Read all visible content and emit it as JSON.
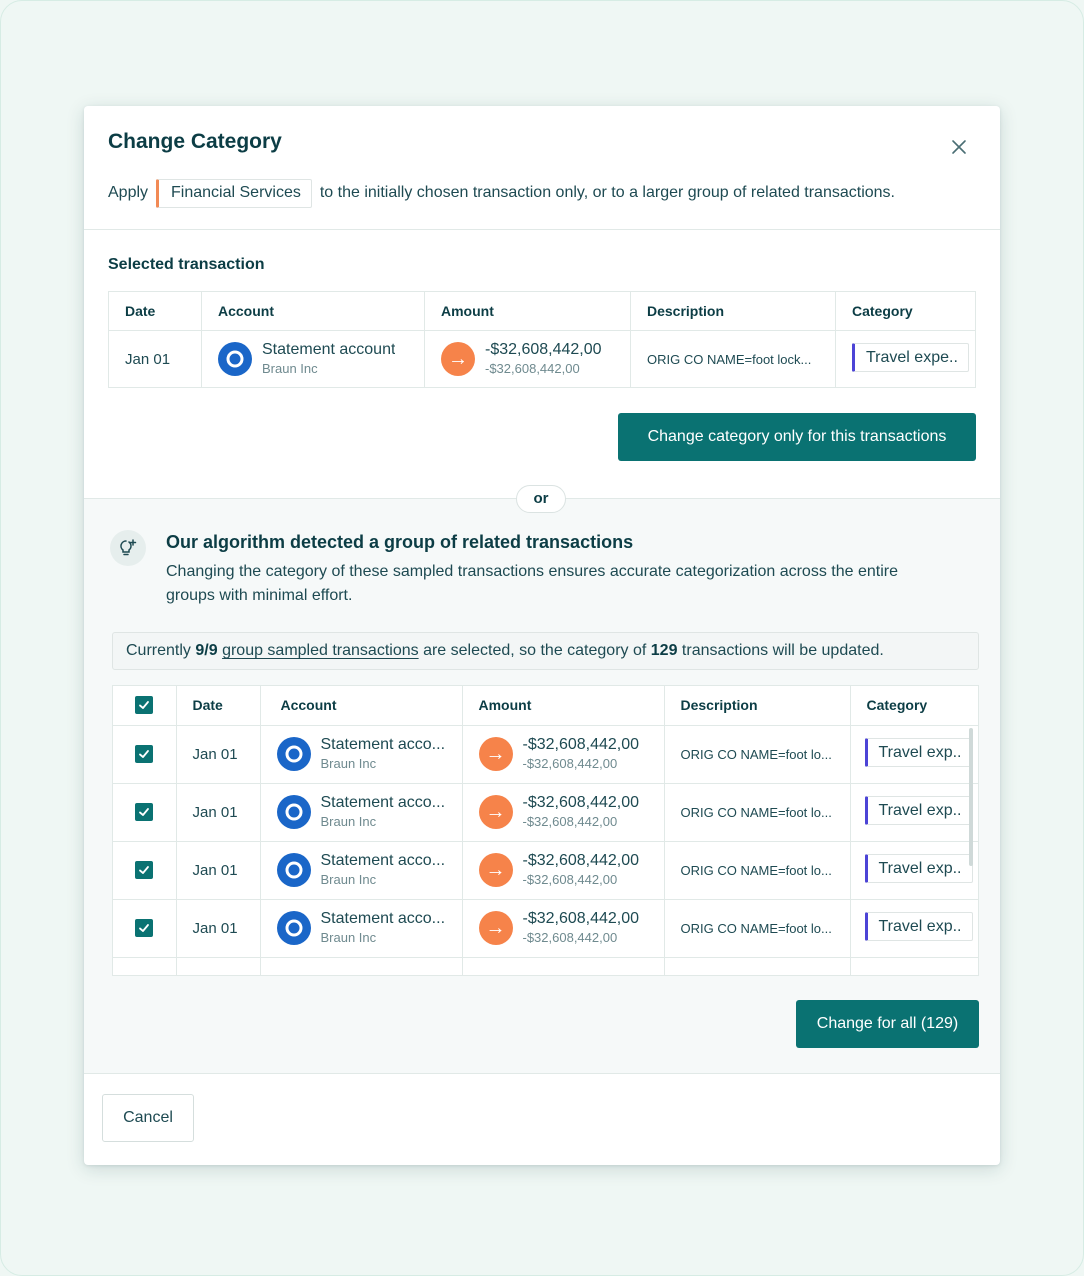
{
  "modal": {
    "title": "Change Category",
    "apply_prefix": "Apply",
    "apply_category": "Financial Services",
    "apply_suffix": "to the initially chosen transaction only, or to a larger group of related transactions."
  },
  "selected": {
    "label": "Selected transaction",
    "columns": [
      "Date",
      "Account",
      "Amount",
      "Description",
      "Category"
    ],
    "row": {
      "date": "Jan 01",
      "account": "Statement account",
      "account_sub": "Braun Inc",
      "amount": "-$32,608,442,00",
      "amount_sub": "-$32,608,442,00",
      "description": "ORIG CO NAME=foot lock...",
      "category": "Travel expe.."
    },
    "button_label": "Change category only for this transactions"
  },
  "divider": {
    "label": "or"
  },
  "group": {
    "title": "Our algorithm detected a group of related transactions",
    "description": "Changing the category of these sampled transactions ensures accurate categorization across the entire groups with minimal effort.",
    "notice": {
      "prefix": "Currently ",
      "selected_count": "9/9",
      "link": "group sampled transactions",
      "middle": " are selected, so the category of ",
      "total": "129",
      "suffix": " transactions will be updated."
    },
    "columns": [
      "Date",
      "Account",
      "Amount",
      "Description",
      "Category"
    ],
    "rows": [
      {
        "date": "Jan 01",
        "account": "Statement acco...",
        "account_sub": "Braun Inc",
        "amount": "-$32,608,442,00",
        "amount_sub": "-$32,608,442,00",
        "description": "ORIG CO NAME=foot lo...",
        "category": "Travel exp.."
      },
      {
        "date": "Jan 01",
        "account": "Statement acco...",
        "account_sub": "Braun Inc",
        "amount": "-$32,608,442,00",
        "amount_sub": "-$32,608,442,00",
        "description": "ORIG CO NAME=foot lo...",
        "category": "Travel exp.."
      },
      {
        "date": "Jan 01",
        "account": "Statement acco...",
        "account_sub": "Braun Inc",
        "amount": "-$32,608,442,00",
        "amount_sub": "-$32,608,442,00",
        "description": "ORIG CO NAME=foot lo...",
        "category": "Travel exp.."
      },
      {
        "date": "Jan 01",
        "account": "Statement acco...",
        "account_sub": "Braun Inc",
        "amount": "-$32,608,442,00",
        "amount_sub": "-$32,608,442,00",
        "description": "ORIG CO NAME=foot lo...",
        "category": "Travel exp.."
      }
    ],
    "button_label": "Change for all (129)"
  },
  "footer": {
    "cancel_label": "Cancel"
  },
  "colors": {
    "primary": "#0a7272",
    "chip_accent": "#f28a55",
    "category_accent": "#4c44d6",
    "amount_icon": "#f6834a",
    "bank_icon": "#1a66c8"
  },
  "icons": {
    "close": "close-icon",
    "bank": "bank-logo-icon",
    "amount": "arrow-right-icon",
    "bulb": "lightbulb-sparkle-icon",
    "checkbox": "check-icon"
  }
}
